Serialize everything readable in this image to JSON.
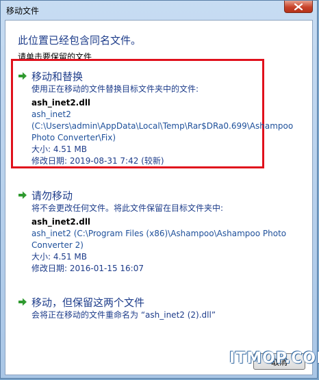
{
  "window": {
    "title": "移动文件"
  },
  "dialog": {
    "heading": "此位置已经包含同名文件。",
    "subheading": "请单击要保留的文件"
  },
  "options": [
    {
      "title": "移动和替换",
      "description": "使用正在移动的文件替换目标文件夹中的文件:",
      "filename": "ash_inet2.dll",
      "path_lines": [
        "ash_inet2",
        "(C:\\Users\\admin\\AppData\\Local\\Temp\\Rar$DRa0.699\\Ashampoo",
        "Photo Converter\\Fix)"
      ],
      "size": "大小: 4.51 MB",
      "modified": "修改日期: 2019-08-31 7:42 (较新)"
    },
    {
      "title": "请勿移动",
      "description": "将不会更改任何文件。将此文件保留在目标文件夹中:",
      "filename": "ash_inet2.dll",
      "path_lines": [
        "ash_inet2 (C:\\Program Files (x86)\\Ashampoo\\Ashampoo Photo",
        "Converter 2)"
      ],
      "size": "大小: 4.51 MB",
      "modified": "修改日期: 2016-01-15 16:07"
    },
    {
      "title": "移动，但保留这两个文件",
      "description": "会将正在移动的文件重命名为 “ash_inet2 (2).dll”"
    }
  ],
  "buttons": {
    "cancel": "取消"
  },
  "watermark": "ITMOP.COM",
  "colors": {
    "highlight": "#e0101c",
    "link_blue": "#1d3c8a",
    "arrow_green": "#2f9a2f"
  }
}
